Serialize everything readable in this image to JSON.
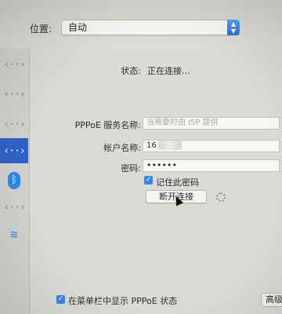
{
  "location": {
    "label": "位置:",
    "value": "自动"
  },
  "sidebar": {
    "items": [
      {
        "icon": "network-arrows-icon",
        "glyph": "‹··›"
      },
      {
        "icon": "network-arrows-icon",
        "glyph": "‹··›"
      },
      {
        "icon": "network-arrows-icon",
        "glyph": "‹··›"
      },
      {
        "icon": "network-arrows-icon",
        "glyph": "‹··›",
        "selected": true
      },
      {
        "icon": "bluetooth-icon",
        "glyph": "ᛒ"
      },
      {
        "icon": "network-arrows-icon",
        "glyph": "‹··›"
      },
      {
        "icon": "wifi-icon",
        "glyph": "≋"
      }
    ]
  },
  "status": {
    "label": "状态:",
    "value": "正在连接..."
  },
  "pppoe_service": {
    "label": "PPPoE 服务名称:",
    "placeholder": "当需要时由 ISP 提供"
  },
  "account": {
    "label": "帐户名称:",
    "value": "16"
  },
  "password": {
    "label": "密码:",
    "value": "••••••"
  },
  "remember_password": {
    "label": "记住此密码",
    "checked": true
  },
  "disconnect_button": {
    "label": "断开连接"
  },
  "show_in_menubar": {
    "label": "在菜单栏中显示 PPPoE 状态",
    "checked": true
  },
  "advanced_button": {
    "label": "高级"
  },
  "colors": {
    "accent": "#2f63c8",
    "checkbox": "#3a86e6"
  }
}
